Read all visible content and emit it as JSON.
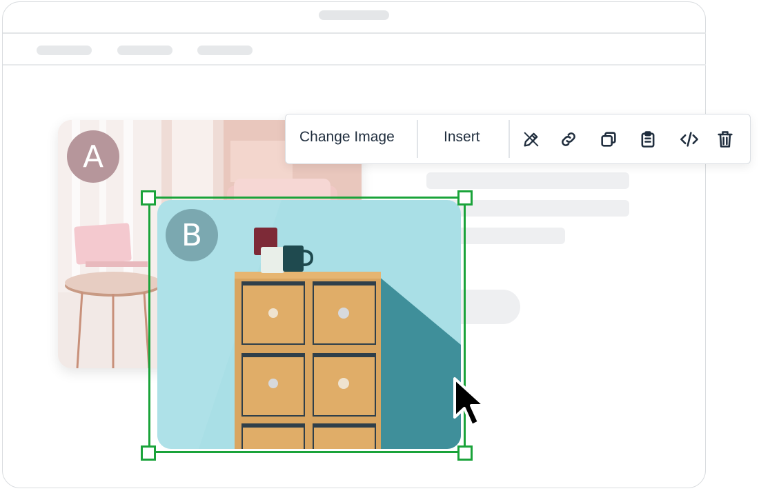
{
  "badges": {
    "a": "A",
    "b": "B"
  },
  "toolbar": {
    "change_image_label": "Change Image",
    "insert_label": "Insert",
    "icons": [
      "edit-pencil-icon",
      "link-icon",
      "duplicate-icon",
      "clipboard-icon",
      "code-icon",
      "trash-icon"
    ]
  },
  "colors": {
    "selection": "#1aa33a",
    "toolbar_text": "#1f2d3d",
    "badge_a": "#b6969b",
    "badge_b": "#7ba8b0"
  }
}
